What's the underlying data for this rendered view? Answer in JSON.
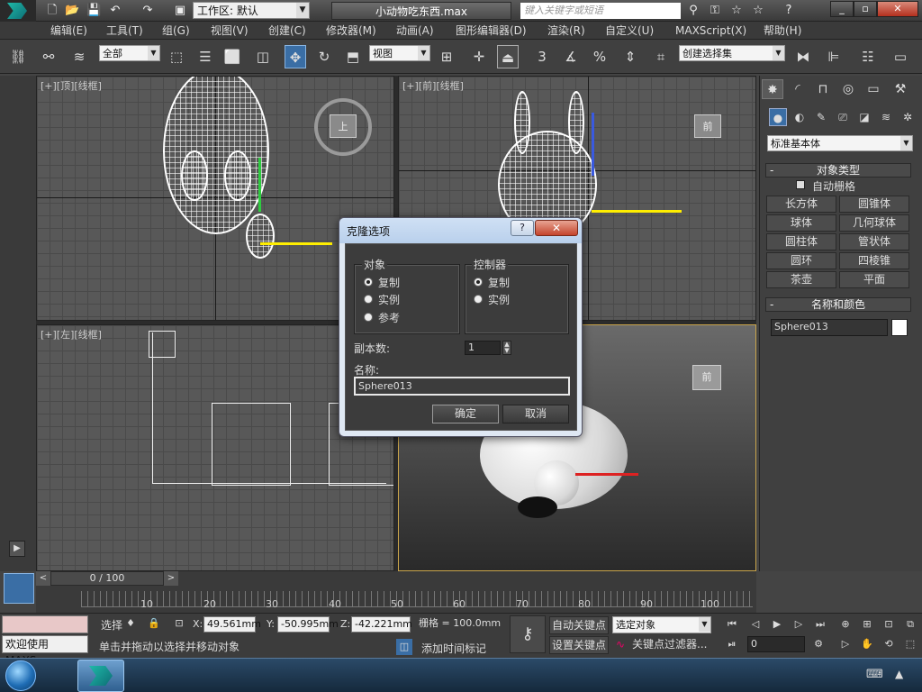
{
  "titlebar": {
    "workspace": "工作区: 默认",
    "file_title": "小动物吃东西.max",
    "search_placeholder": "键入关键字或短语"
  },
  "menu": [
    "编辑(E)",
    "工具(T)",
    "组(G)",
    "视图(V)",
    "创建(C)",
    "修改器(M)",
    "动画(A)",
    "图形编辑器(D)",
    "渲染(R)",
    "自定义(U)",
    "MAXScript(X)",
    "帮助(H)"
  ],
  "toolbar": {
    "selection_filter": "全部",
    "ref_coord": "视图",
    "snap_3": "3",
    "named_selection": "创建选择集"
  },
  "viewports": {
    "top_label": "[+][顶][线框]",
    "front_label": "[+][前][线框]",
    "left_label": "[+][左][线框]",
    "top_cube": "上",
    "front_cube": "前",
    "persp_cube": "前"
  },
  "command_panel": {
    "category": "标准基本体",
    "object_type_title": "对象类型",
    "autogrid": "自动栅格",
    "buttons": [
      "长方体",
      "圆锥体",
      "球体",
      "几何球体",
      "圆柱体",
      "管状体",
      "圆环",
      "四棱锥",
      "茶壶",
      "平面"
    ],
    "name_color_title": "名称和颜色",
    "object_name": "Sphere013",
    "object_color": "#ffffff"
  },
  "dialog": {
    "title": "克隆选项",
    "object_group": "对象",
    "object_options": [
      "复制",
      "实例",
      "参考"
    ],
    "object_selected": 0,
    "controller_group": "控制器",
    "controller_options": [
      "复制",
      "实例"
    ],
    "controller_selected": 0,
    "copies_label": "副本数:",
    "copies_value": "1",
    "name_label": "名称:",
    "name_value": "Sphere013",
    "ok": "确定",
    "cancel": "取消"
  },
  "timeline": {
    "frame_display": "0 / 100",
    "ticks": [
      "10",
      "20",
      "30",
      "40",
      "50",
      "60",
      "70",
      "80",
      "90",
      "100"
    ]
  },
  "status": {
    "maxscript_welcome": "欢迎使用 MAXSc",
    "selected_label": "选择",
    "x_label": "X:",
    "x_value": "49.561mm",
    "y_label": "Y:",
    "y_value": "-50.995mm",
    "z_label": "Z:",
    "z_value": "-42.221mm",
    "grid": "栅格 = 100.0mm",
    "auto_key": "自动关键点",
    "set_key": "设置关键点",
    "key_mode": "选定对象",
    "key_filters": "关键点过滤器...",
    "frame_field": "0",
    "prompt": "单击并拖动以选择并移动对象",
    "add_time_tag": "添加时间标记"
  },
  "accent": "#3a6ea5"
}
